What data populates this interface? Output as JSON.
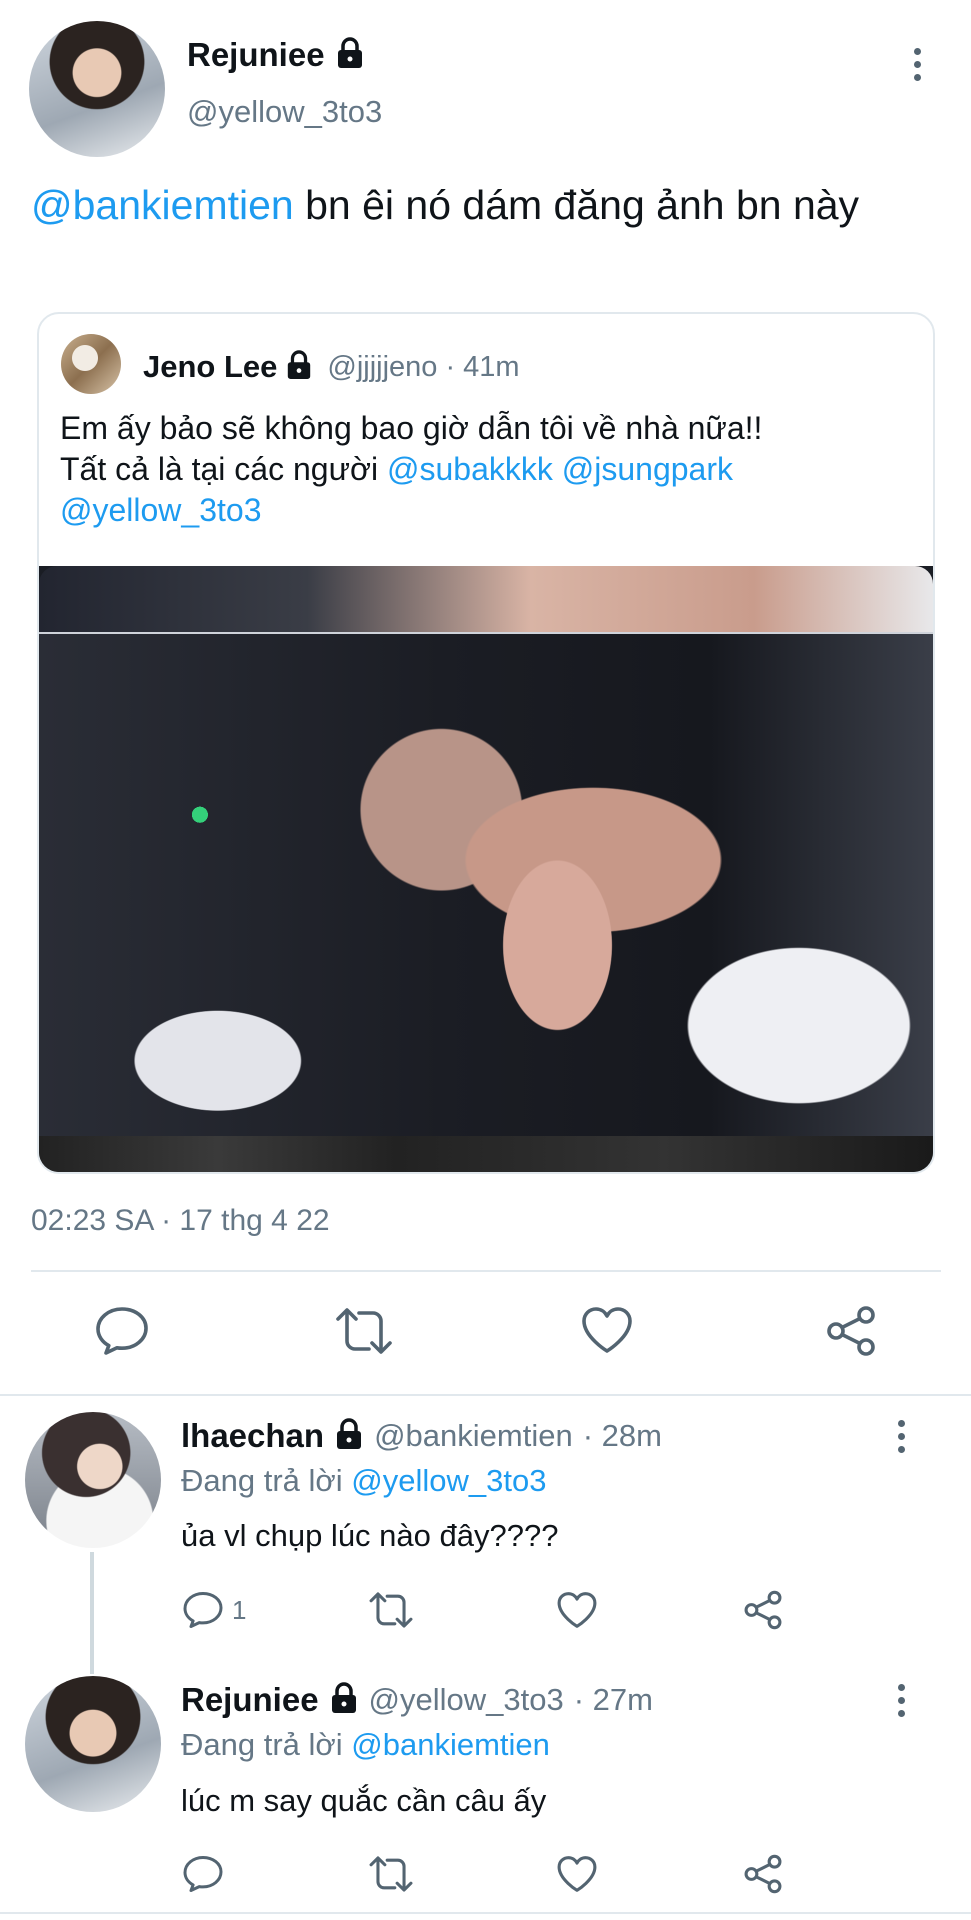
{
  "main_tweet": {
    "display_name": "Rejuniee",
    "handle": "@yellow_3to3",
    "text_mention": "@bankiemtien",
    "text_body": "bn êi nó dám đăng ảnh bn này",
    "timestamp": "02:23 SA · 17 thg 4 22"
  },
  "quoted_tweet": {
    "display_name": "Jeno Lee",
    "handle": "@jjjjjeno",
    "time": "· 41m",
    "line1": "Em ấy bảo sẽ không bao giờ dẫn tôi về nhà nữa!!",
    "line2_prefix": "Tất cả là tại các người",
    "mention1": "@subakkkk",
    "mention2": "@jsungpark",
    "mention3": "@yellow_3to3"
  },
  "replies": [
    {
      "display_name": "lhaechan",
      "handle": "@bankiemtien",
      "time": "· 28m",
      "replying_prefix": "Đang trả lời",
      "replying_to": "@yellow_3to3",
      "text": "ủa vl chụp lúc nào đây????",
      "reply_count": "1"
    },
    {
      "display_name": "Rejuniee",
      "handle": "@yellow_3to3",
      "time": "· 27m",
      "replying_prefix": "Đang trả lời",
      "replying_to": "@bankiemtien",
      "text": "lúc m say quắc cần câu ấy",
      "reply_count": ""
    }
  ],
  "colors": {
    "link": "#1d9bf0",
    "secondary": "#657786",
    "icon": "#536471",
    "divider": "#e1e8ed"
  }
}
